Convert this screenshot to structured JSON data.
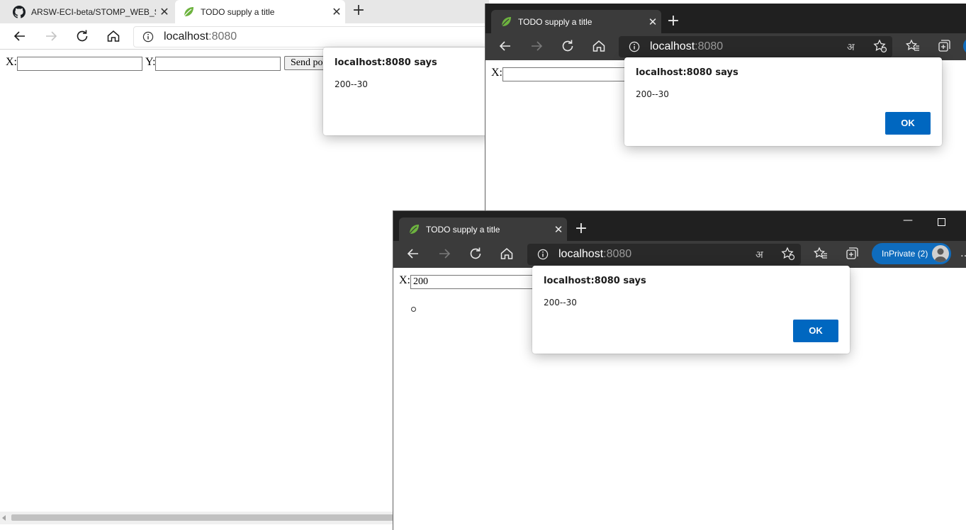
{
  "window1": {
    "tabs": [
      {
        "label": "ARSW-ECI-beta/STOMP_WEB_SC",
        "icon": "github-icon"
      },
      {
        "label": "TODO supply a title",
        "icon": "spring-leaf-icon"
      }
    ],
    "address": {
      "host": "localhost",
      "port": ":8080"
    },
    "form": {
      "x_label": "X:",
      "y_label": "Y:",
      "x_value": "",
      "y_value": "",
      "send_label": "Send point"
    },
    "dialog": {
      "title": "localhost:8080 says",
      "message": "200--30"
    }
  },
  "window2": {
    "tab": {
      "label": "TODO supply a title",
      "icon": "spring-leaf-icon"
    },
    "address": {
      "host": "localhost",
      "port": ":8080"
    },
    "form": {
      "x_label": "X:",
      "x_value": ""
    },
    "dialog": {
      "title": "localhost:8080 says",
      "message": "200--30",
      "ok_label": "OK"
    }
  },
  "window3": {
    "tab": {
      "label": "TODO supply a title",
      "icon": "spring-leaf-icon"
    },
    "address": {
      "host": "localhost",
      "port": ":8080"
    },
    "inprivate_label": "InPrivate (2)",
    "form": {
      "x_label": "X:",
      "x_value": "200"
    },
    "dialog": {
      "title": "localhost:8080 says",
      "message": "200--30",
      "ok_label": "OK"
    }
  },
  "colors": {
    "accent": "#0067c0",
    "dark_chrome": "#3b3b3b",
    "dark_tabstrip": "#202020",
    "light_tabstrip": "#e7e7e7"
  }
}
